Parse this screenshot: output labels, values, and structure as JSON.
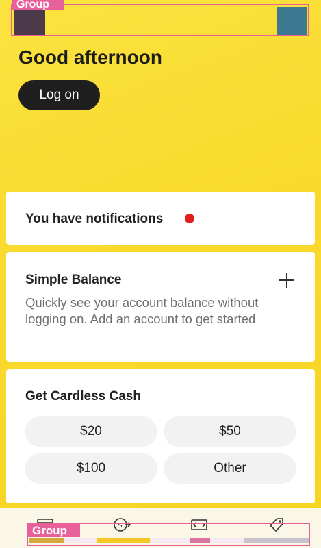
{
  "annotations": {
    "top_group_label": "Group",
    "bottom_group_label": "Group"
  },
  "header": {
    "greeting": "Good afternoon",
    "logon_label": "Log on"
  },
  "notifications": {
    "text": "You have notifications"
  },
  "simple_balance": {
    "title": "Simple Balance",
    "description": "Quickly see your account balance without logging on. Add an account to get started"
  },
  "cardless_cash": {
    "title": "Get Cardless Cash",
    "amounts": [
      "$20",
      "$50",
      "$100",
      "Other"
    ]
  },
  "bottom_nav": {
    "icons": [
      "accounts-icon",
      "transfer-icon",
      "pay-icon",
      "offers-icon"
    ]
  },
  "colors": {
    "background": "#f9d92c",
    "accent_dark": "#1f1f1f",
    "notification_dot": "#e01e1e",
    "annotation": "#e8609a"
  }
}
